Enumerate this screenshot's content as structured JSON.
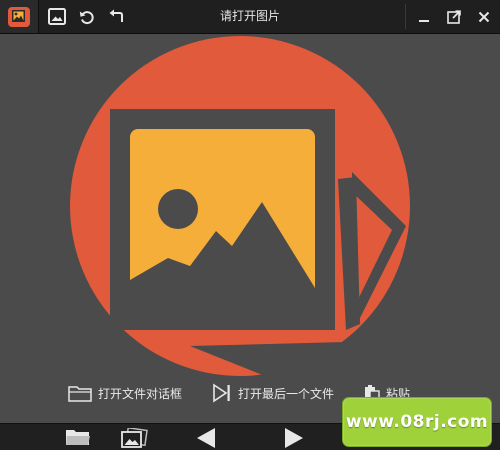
{
  "window": {
    "title": "请打开图片"
  },
  "toolbar": {
    "icons": [
      "app-logo-icon",
      "gallery-icon",
      "rotate-icon",
      "undo-icon"
    ]
  },
  "window_controls": {
    "icons": [
      "minimize-icon",
      "maximize-icon",
      "close-icon"
    ]
  },
  "actions": {
    "open_dialog_label": "打开文件对话框",
    "open_recent_label": "打开最后一个文件",
    "paste_label": "粘贴"
  },
  "bottom_toolbar": {
    "icons": [
      "open-folder-icon",
      "slideshow-icon",
      "previous-icon",
      "next-icon"
    ]
  },
  "watermark": {
    "text": "www.08rj.com"
  },
  "colors": {
    "background": "#4b4b4b",
    "titlebar": "#1f1f1f",
    "circle": "#e05a3b",
    "photo": "#f6ae3b",
    "watermark": "#9fd13a"
  }
}
